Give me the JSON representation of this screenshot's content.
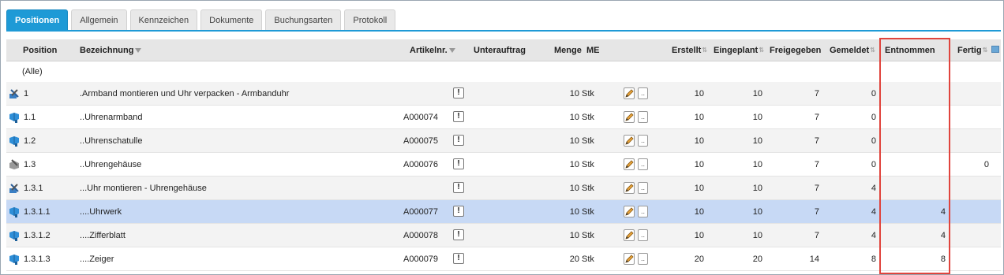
{
  "tabs": [
    "Positionen",
    "Allgemein",
    "Kennzeichen",
    "Dokumente",
    "Buchungsarten",
    "Protokoll"
  ],
  "active_tab": 0,
  "columns": {
    "position": "Position",
    "bezeichnung": "Bezeichnung",
    "artikelnr": "Artikelnr.",
    "unterauftrag": "Unterauftrag",
    "menge": "Menge",
    "me": "ME",
    "erstellt": "Erstellt",
    "eingeplant": "Eingeplant",
    "freigegeben": "Freigegeben",
    "gemeldet": "Gemeldet",
    "entnommen": "Entnommen",
    "fertig": "Fertig"
  },
  "filter_all": "(Alle)",
  "rows": [
    {
      "icon": "assembly-icon",
      "position": "1",
      "bezeichnung": ".Armband montieren und Uhr verpacken - Armbanduhr",
      "artikelnr": "",
      "menge": "10",
      "me": "Stk",
      "erstellt": "10",
      "eingeplant": "10",
      "freigegeben": "7",
      "gemeldet": "0",
      "entnommen": "",
      "fertig": "",
      "selected": false
    },
    {
      "icon": "part-icon",
      "position": "1.1",
      "bezeichnung": "..Uhrenarmband",
      "artikelnr": "A000074",
      "menge": "10",
      "me": "Stk",
      "erstellt": "10",
      "eingeplant": "10",
      "freigegeben": "7",
      "gemeldet": "0",
      "entnommen": "",
      "fertig": "",
      "selected": false
    },
    {
      "icon": "part-icon",
      "position": "1.2",
      "bezeichnung": "..Uhrenschatulle",
      "artikelnr": "A000075",
      "menge": "10",
      "me": "Stk",
      "erstellt": "10",
      "eingeplant": "10",
      "freigegeben": "7",
      "gemeldet": "0",
      "entnommen": "",
      "fertig": "",
      "selected": false
    },
    {
      "icon": "manufactured-part-icon",
      "position": "1.3",
      "bezeichnung": "..Uhrengehäuse",
      "artikelnr": "A000076",
      "menge": "10",
      "me": "Stk",
      "erstellt": "10",
      "eingeplant": "10",
      "freigegeben": "7",
      "gemeldet": "0",
      "entnommen": "",
      "fertig": "0",
      "selected": false
    },
    {
      "icon": "assembly-icon",
      "position": "1.3.1",
      "bezeichnung": "...Uhr montieren - Uhrengehäuse",
      "artikelnr": "",
      "menge": "10",
      "me": "Stk",
      "erstellt": "10",
      "eingeplant": "10",
      "freigegeben": "7",
      "gemeldet": "4",
      "entnommen": "",
      "fertig": "",
      "selected": false
    },
    {
      "icon": "part-icon",
      "position": "1.3.1.1",
      "bezeichnung": "....Uhrwerk",
      "artikelnr": "A000077",
      "menge": "10",
      "me": "Stk",
      "erstellt": "10",
      "eingeplant": "10",
      "freigegeben": "7",
      "gemeldet": "4",
      "entnommen": "4",
      "fertig": "",
      "selected": true
    },
    {
      "icon": "part-icon",
      "position": "1.3.1.2",
      "bezeichnung": "....Zifferblatt",
      "artikelnr": "A000078",
      "menge": "10",
      "me": "Stk",
      "erstellt": "10",
      "eingeplant": "10",
      "freigegeben": "7",
      "gemeldet": "4",
      "entnommen": "4",
      "fertig": "",
      "selected": false
    },
    {
      "icon": "part-icon",
      "position": "1.3.1.3",
      "bezeichnung": "....Zeiger",
      "artikelnr": "A000079",
      "menge": "20",
      "me": "Stk",
      "erstellt": "20",
      "eingeplant": "20",
      "freigegeben": "14",
      "gemeldet": "8",
      "entnommen": "8",
      "fertig": "",
      "selected": false
    }
  ],
  "bang_label": "!",
  "dots_label": "..",
  "colors": {
    "accent": "#1e9ad6",
    "highlight": "#e0443d",
    "selected_row": "#c7d9f5"
  }
}
